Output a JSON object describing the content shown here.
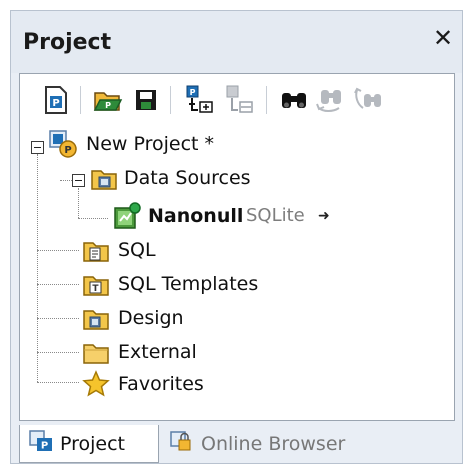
{
  "window": {
    "title": "Project",
    "close_glyph": "✕"
  },
  "toolbar": {
    "buttons": [
      {
        "icon": "new-project-icon"
      },
      {
        "icon": "open-project-icon"
      },
      {
        "icon": "save-project-icon"
      },
      {
        "icon": "add-to-project-icon"
      },
      {
        "icon": "add-folder-icon"
      },
      {
        "icon": "find-icon"
      },
      {
        "icon": "find-next-icon"
      },
      {
        "icon": "replace-icon"
      }
    ]
  },
  "tree": {
    "root": {
      "label": "New Project *"
    },
    "data_sources": {
      "label": "Data Sources"
    },
    "datasource": {
      "name": "Nanonull",
      "type": "SQLite",
      "arrow": "➜"
    },
    "folders": [
      {
        "label": "SQL",
        "icon": "sql-folder-icon"
      },
      {
        "label": "SQL Templates",
        "icon": "templates-folder-icon"
      },
      {
        "label": "Design",
        "icon": "design-folder-icon"
      },
      {
        "label": "External",
        "icon": "external-folder-icon"
      },
      {
        "label": "Favorites",
        "icon": "favorites-star-icon"
      }
    ]
  },
  "tabs": [
    {
      "label": "Project",
      "active": true
    },
    {
      "label": "Online Browser",
      "active": false
    }
  ],
  "colors": {
    "panel_bg": "#e9eef5",
    "folder": "#f3c64a",
    "accent_blue": "#1f6fb5",
    "accent_green": "#2e8b3a"
  }
}
